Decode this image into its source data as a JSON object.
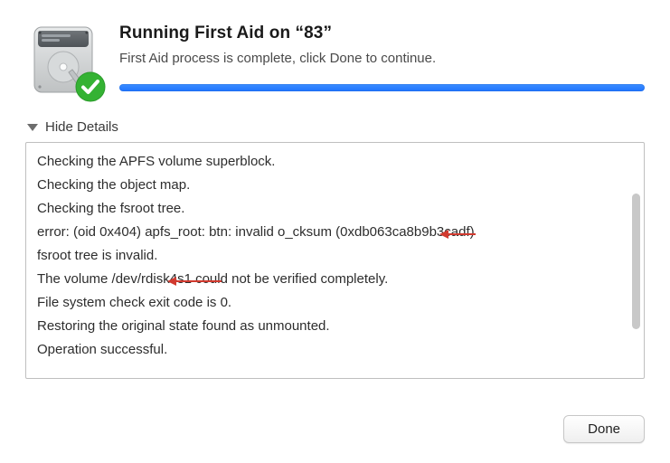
{
  "header": {
    "title": "Running First Aid on “83”",
    "subtitle": "First Aid process is complete, click Done to continue.",
    "progress_pct": 100
  },
  "details": {
    "toggle_label": "Hide Details",
    "log_lines": [
      "Checking the APFS volume superblock.",
      "Checking the object map.",
      "Checking the fsroot tree.",
      "error: (oid 0x404) apfs_root: btn: invalid o_cksum (0xdb063ca8b9b3cadf)",
      "fsroot tree is invalid.",
      "The volume /dev/rdisk4s1 could not be verified completely.",
      "File system check exit code is 0.",
      "Restoring the original state found as unmounted.",
      "Operation successful."
    ]
  },
  "icons": {
    "disk": "internal-hard-disk-icon",
    "status_badge": "success-check-icon",
    "disclosure": "disclosure-triangle-icon"
  },
  "colors": {
    "progress": "#1f74ff",
    "badge_green": "#34b233",
    "annotation_red": "#d13a2f"
  },
  "footer": {
    "done_label": "Done"
  }
}
